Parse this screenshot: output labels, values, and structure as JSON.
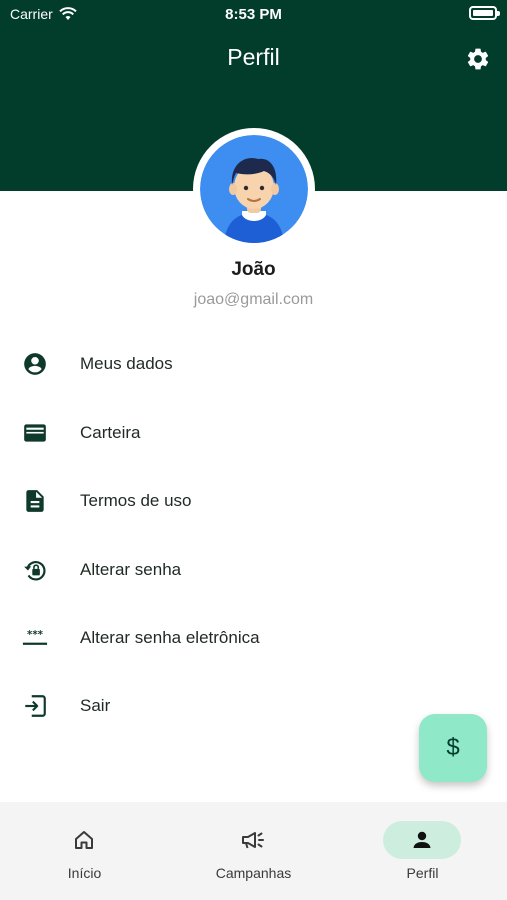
{
  "status_bar": {
    "carrier": "Carrier",
    "time": "8:53 PM"
  },
  "header": {
    "title": "Perfil"
  },
  "profile": {
    "name": "João",
    "email": "joao@gmail.com"
  },
  "menu": {
    "items": [
      {
        "label": "Meus dados",
        "icon": "account-circle-icon"
      },
      {
        "label": "Carteira",
        "icon": "wallet-icon"
      },
      {
        "label": "Termos de uso",
        "icon": "document-icon"
      },
      {
        "label": "Alterar senha",
        "icon": "lock-reset-icon"
      },
      {
        "label": "Alterar senha eletrônica",
        "icon": "password-dots-icon"
      },
      {
        "label": "Sair",
        "icon": "logout-icon"
      }
    ]
  },
  "fab": {
    "symbol": "$"
  },
  "bottom_nav": {
    "items": [
      {
        "label": "Início",
        "icon": "home-icon",
        "active": false
      },
      {
        "label": "Campanhas",
        "icon": "megaphone-icon",
        "active": false
      },
      {
        "label": "Perfil",
        "icon": "person-icon",
        "active": true
      }
    ]
  },
  "colors": {
    "header_bg": "#023d2c",
    "fab_bg": "#8fe8c8",
    "active_pill": "#cdeede",
    "icon": "#0f3a2b"
  }
}
